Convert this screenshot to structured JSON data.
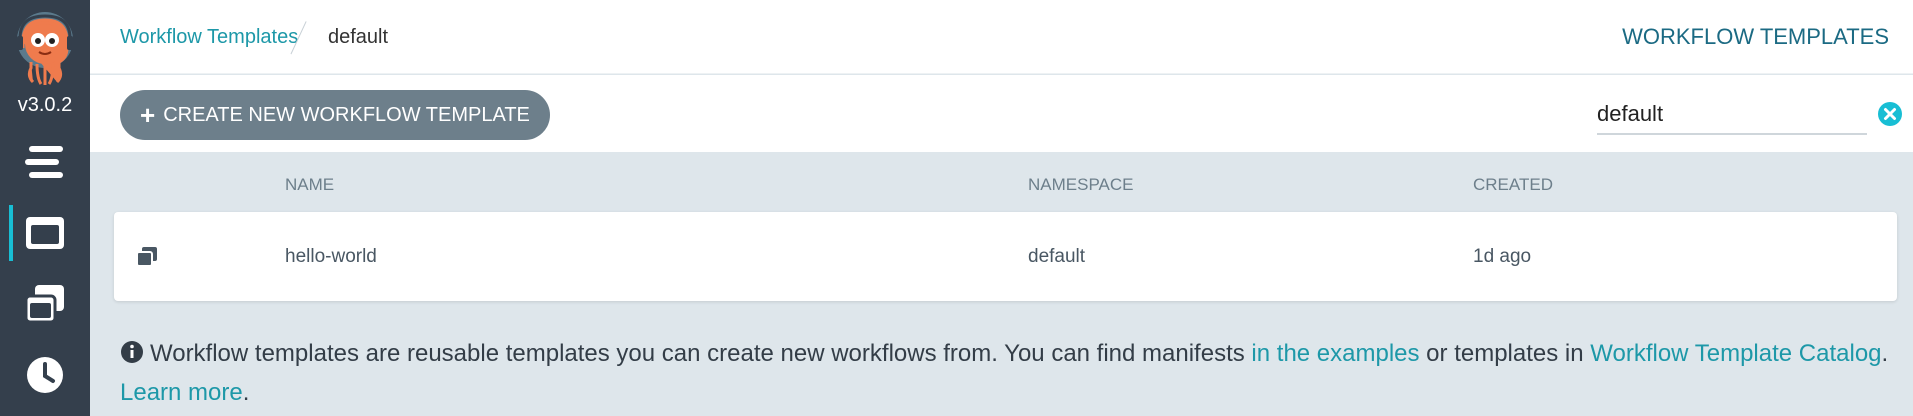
{
  "sidebar": {
    "version": "v3.0.2",
    "items": [
      {
        "name": "menu-icon"
      },
      {
        "name": "workflow-templates-icon",
        "active": true
      },
      {
        "name": "cluster-workflow-templates-icon"
      },
      {
        "name": "cron-workflows-icon"
      }
    ]
  },
  "breadcrumb": {
    "link": "Workflow Templates",
    "current": "default"
  },
  "page_title": "WORKFLOW TEMPLATES",
  "toolbar": {
    "create_label": "CREATE NEW WORKFLOW TEMPLATE",
    "namespace_value": "default"
  },
  "table": {
    "columns": [
      "NAME",
      "NAMESPACE",
      "CREATED"
    ],
    "rows": [
      {
        "name": "hello-world",
        "namespace": "default",
        "created": "1d ago"
      }
    ]
  },
  "info": {
    "text1": "Workflow templates are reusable templates you can create new workflows from. You can find manifests ",
    "link1": "in the examples",
    "text2": " or templates in ",
    "link2": "Workflow Template Catalog",
    "text3": ".",
    "link3": "Learn more",
    "text4": "."
  },
  "colors": {
    "sidebar_bg": "#343f4c",
    "accent": "#18bed4",
    "link": "#1d98a8",
    "button_bg": "#6d7f8b",
    "content_bg": "#dee6eb"
  }
}
